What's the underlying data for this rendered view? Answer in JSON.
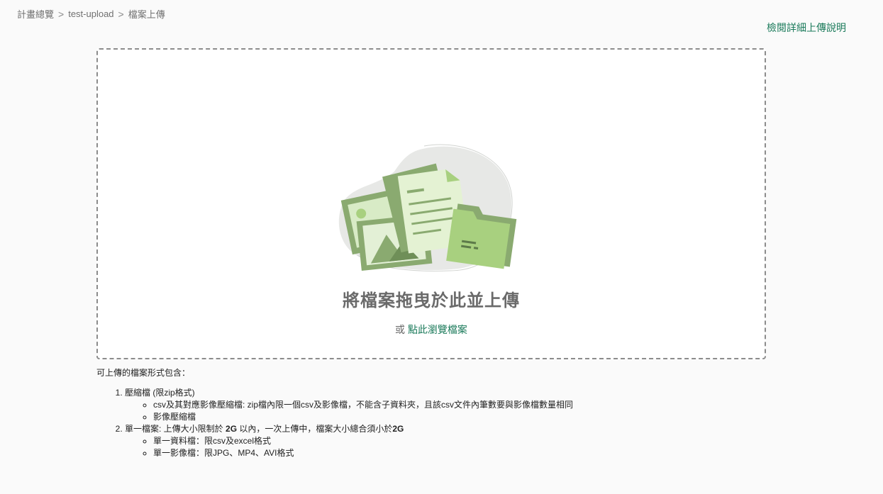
{
  "breadcrumb": {
    "items": [
      "計畫總覽",
      "test-upload",
      "檔案上傳"
    ],
    "separator": ">"
  },
  "help_link": "檢閱詳細上傳說明",
  "dropzone": {
    "title": "將檔案拖曳於此並上傳",
    "or_text": "或",
    "browse_link": "點此瀏覽檔案",
    "illustration_icon": "files-upload-illustration"
  },
  "formats": {
    "intro": "可上傳的檔案形式包含：",
    "item1": {
      "label": "壓縮檔 (限zip格式)",
      "sub": [
        "csv及其對應影像壓縮檔: zip檔內限一個csv及影像檔，不能含子資料夾，且該csv文件內筆數要與影像檔數量相同",
        "影像壓縮檔"
      ]
    },
    "item2": {
      "label_prefix": "單一檔案: 上傳大小限制於 ",
      "size_limit": "2G",
      "label_mid": " 以內，一次上傳中，檔案大小總合須小於",
      "total_limit": "2G",
      "sub": [
        "單一資料檔：限csv及excel格式",
        "單一影像檔：限JPG、MP4、AVI格式"
      ]
    }
  },
  "colors": {
    "accent": "#1a7a5a",
    "green_dark": "#8aaa70",
    "green_light": "#a8d07f"
  }
}
